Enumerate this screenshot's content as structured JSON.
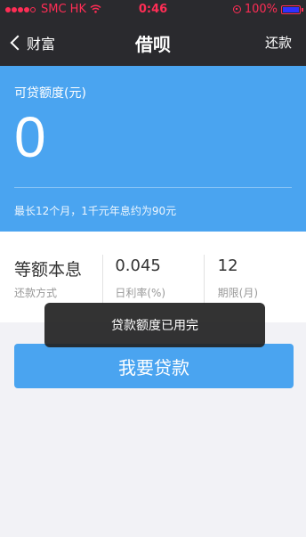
{
  "status_bar": {
    "carrier": "SMC HK",
    "time": "0:46",
    "battery": "100%",
    "signal_icon": "signal-dots-icon",
    "wifi_icon": "wifi-icon",
    "lock_icon": "orientation-lock-icon",
    "battery_icon": "battery-icon"
  },
  "nav": {
    "back_label": "财富",
    "title": "借呗",
    "right_label": "还款",
    "back_icon": "chevron-left-icon"
  },
  "credit": {
    "label": "可贷额度(元)",
    "amount": "0",
    "note": "最长12个月，1千元年息约为90元"
  },
  "info": [
    {
      "value": "等额本息",
      "label": "还款方式"
    },
    {
      "value": "0.045",
      "label": "日利率(%)"
    },
    {
      "value": "12",
      "label": "期限(月)"
    }
  ],
  "toast": {
    "message": "贷款额度已用完"
  },
  "apply_button": {
    "label": "我要贷款"
  },
  "colors": {
    "accent": "#4aa4f0",
    "nav_bg": "#2a2a2e",
    "status_red": "#ff2d55",
    "page_bg": "#f2f2f6"
  }
}
